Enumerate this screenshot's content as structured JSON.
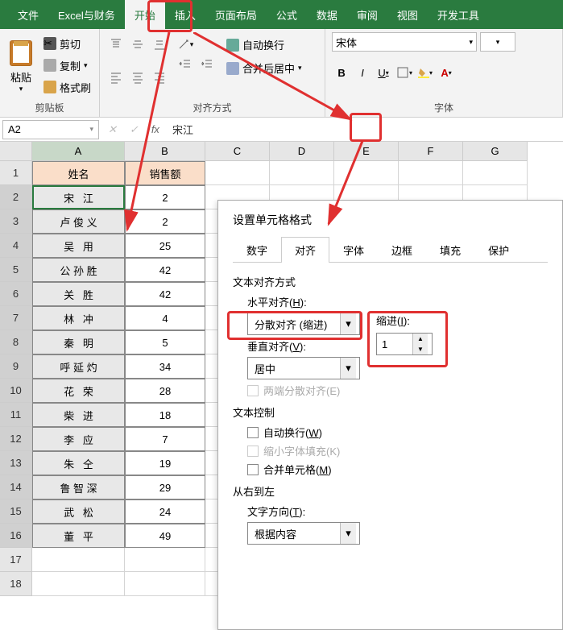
{
  "ribbon": {
    "tabs": [
      "文件",
      "Excel与财务",
      "开始",
      "插入",
      "页面布局",
      "公式",
      "数据",
      "审阅",
      "视图",
      "开发工具"
    ],
    "active_tab": "开始",
    "clipboard": {
      "paste": "粘贴",
      "cut": "剪切",
      "copy": "复制",
      "format_painter": "格式刷",
      "group_label": "剪贴板"
    },
    "alignment": {
      "wrap_text": "自动换行",
      "merge_center": "合并后居中",
      "group_label": "对齐方式"
    },
    "font": {
      "font_name": "宋体",
      "bold": "B",
      "italic": "I",
      "underline": "U",
      "group_label": "字体"
    }
  },
  "cell_ref": {
    "name": "A2",
    "formula": "宋江"
  },
  "table": {
    "columns": [
      "A",
      "B",
      "C",
      "D",
      "E",
      "F",
      "G"
    ],
    "headers": {
      "name": "姓名",
      "sales": "销售额"
    },
    "rows": [
      {
        "name": "宋   江",
        "sales": "2"
      },
      {
        "name": "卢 俊 义",
        "sales": "2"
      },
      {
        "name": "吴   用",
        "sales": "25"
      },
      {
        "name": "公 孙 胜",
        "sales": "42"
      },
      {
        "name": "关   胜",
        "sales": "42"
      },
      {
        "name": "林   冲",
        "sales": "4"
      },
      {
        "name": "秦   明",
        "sales": "5"
      },
      {
        "name": "呼 延 灼",
        "sales": "34"
      },
      {
        "name": "花   荣",
        "sales": "28"
      },
      {
        "name": "柴   进",
        "sales": "18"
      },
      {
        "name": "李   应",
        "sales": "7"
      },
      {
        "name": "朱   仝",
        "sales": "19"
      },
      {
        "name": "鲁 智 深",
        "sales": "29"
      },
      {
        "name": "武   松",
        "sales": "24"
      },
      {
        "name": "董   平",
        "sales": "49"
      }
    ]
  },
  "dialog": {
    "title": "设置单元格格式",
    "tabs": [
      "数字",
      "对齐",
      "字体",
      "边框",
      "填充",
      "保护"
    ],
    "active_tab": "对齐",
    "text_align_section": "文本对齐方式",
    "h_align_label": "水平对齐(H):",
    "h_align_value": "分散对齐 (缩进)",
    "indent_label": "缩进(I):",
    "indent_value": "1",
    "v_align_label": "垂直对齐(V):",
    "v_align_value": "居中",
    "justify_distributed": "两端分散对齐(E)",
    "text_control_section": "文本控制",
    "wrap_text": "自动换行(W)",
    "shrink_fit": "缩小字体填充(K)",
    "merge_cells": "合并单元格(M)",
    "rtl_section": "从右到左",
    "text_dir_label": "文字方向(T):",
    "text_dir_value": "根据内容"
  }
}
